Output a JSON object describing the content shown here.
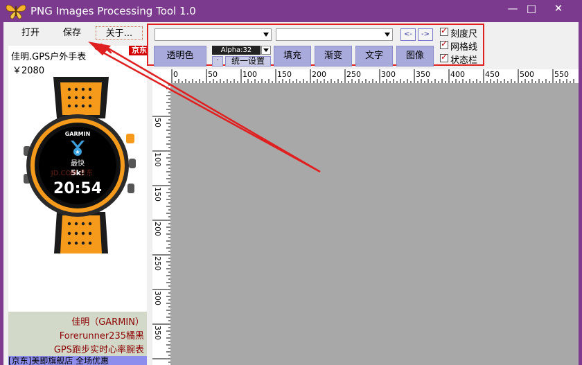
{
  "window": {
    "title": "PNG Images Processing Tool 1.0",
    "minimize_glyph": "—",
    "maximize_glyph": "□",
    "close_glyph": "✕"
  },
  "menu": {
    "open": "打开",
    "save": "保存",
    "about": "关于..."
  },
  "ad": {
    "title": "佳明.GPS户外手表",
    "price": "￥2080",
    "badge": "京东",
    "desc_lines": [
      "佳明（GARMIN）",
      "Forerunner235橘黑",
      "GPS跑步实时心率腕表"
    ],
    "bottom_text": "[京东]美即旗舰店 全场优惠",
    "watch": {
      "brand": "GARMIN",
      "line1": "最快",
      "line2": "5k!",
      "time": "20:54",
      "watermark": "JD.COM 京东"
    }
  },
  "toolbar": {
    "prev": "<-",
    "next": "->",
    "transparent": "透明色",
    "alpha_label": "Alpha:32",
    "dot": "·",
    "apply": "统一设置",
    "fill": "填充",
    "gradient": "渐变",
    "text": "文字",
    "image": "图像"
  },
  "options": {
    "ruler": "刻度尺",
    "grid": "网格线",
    "statusbar": "状态栏"
  },
  "ruler": {
    "h_labels": [
      "0",
      "50",
      "100",
      "150",
      "200",
      "250",
      "300",
      "350",
      "400",
      "450",
      "500",
      "550"
    ],
    "v_labels": [
      "50",
      "100",
      "150",
      "200",
      "250",
      "300",
      "350"
    ]
  },
  "colors": {
    "title_bar": "#7b3a8e",
    "tool_button": "#a8aadc",
    "canvas": "#a8a8a8",
    "highlight": "#e02020"
  }
}
